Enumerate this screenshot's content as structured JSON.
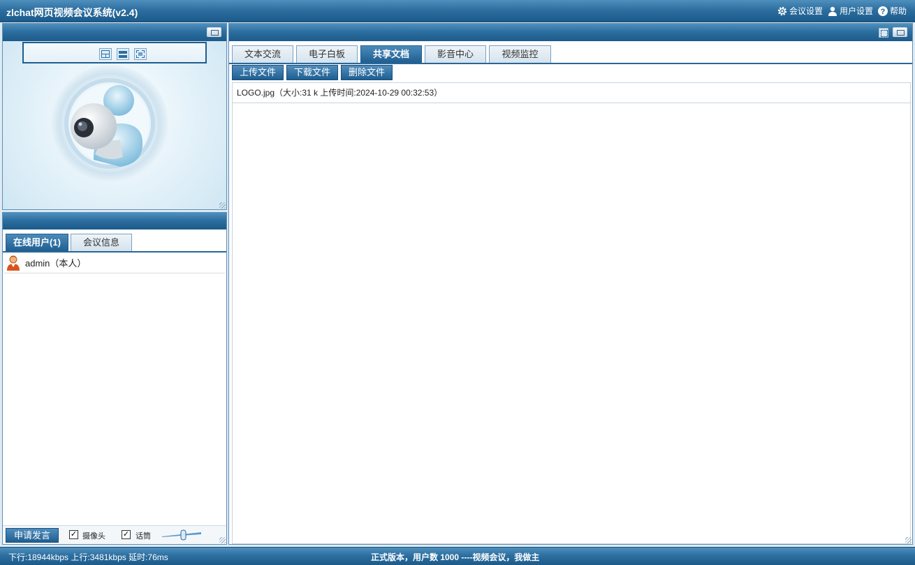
{
  "app": {
    "title": "zlchat网页视频会议系统(v2.4)"
  },
  "top_menu": {
    "meeting_settings": "会议设置",
    "user_settings": "用户设置",
    "help": "帮助",
    "icons": [
      "gear-icon",
      "user-icon",
      "help-icon"
    ]
  },
  "video_panel": {
    "layout_buttons": [
      "grid-layout-icon",
      "single-layout-icon",
      "fullscreen-layout-icon"
    ]
  },
  "left_tabs": [
    {
      "label": "在线用户(1)",
      "active": true
    },
    {
      "label": "会议信息",
      "active": false
    }
  ],
  "users": [
    {
      "name": "admin（本人）"
    }
  ],
  "controls": {
    "apply_speak": "申请发言",
    "camera_label": "摄像头",
    "camera_checked": true,
    "mic_label": "话筒",
    "mic_checked": true
  },
  "main_tabs": [
    {
      "label": "文本交流",
      "active": false
    },
    {
      "label": "电子白板",
      "active": false
    },
    {
      "label": "共享文档",
      "active": true
    },
    {
      "label": "影音中心",
      "active": false
    },
    {
      "label": "视频监控",
      "active": false
    }
  ],
  "doc_toolbar": {
    "upload": "上传文件",
    "download": "下载文件",
    "delete": "删除文件"
  },
  "documents": [
    {
      "text": "LOGO.jpg（大小:31 k 上传时间:2024-10-29 00:32:53）"
    }
  ],
  "status": {
    "net_stats": "下行:18944kbps  上行:3481kbps  延时:76ms",
    "version": "正式版本，用户数 1000 ----视频会议，我做主"
  },
  "colors": {
    "header_blue": "#1f5e90",
    "accent": "#4b8bbb"
  }
}
